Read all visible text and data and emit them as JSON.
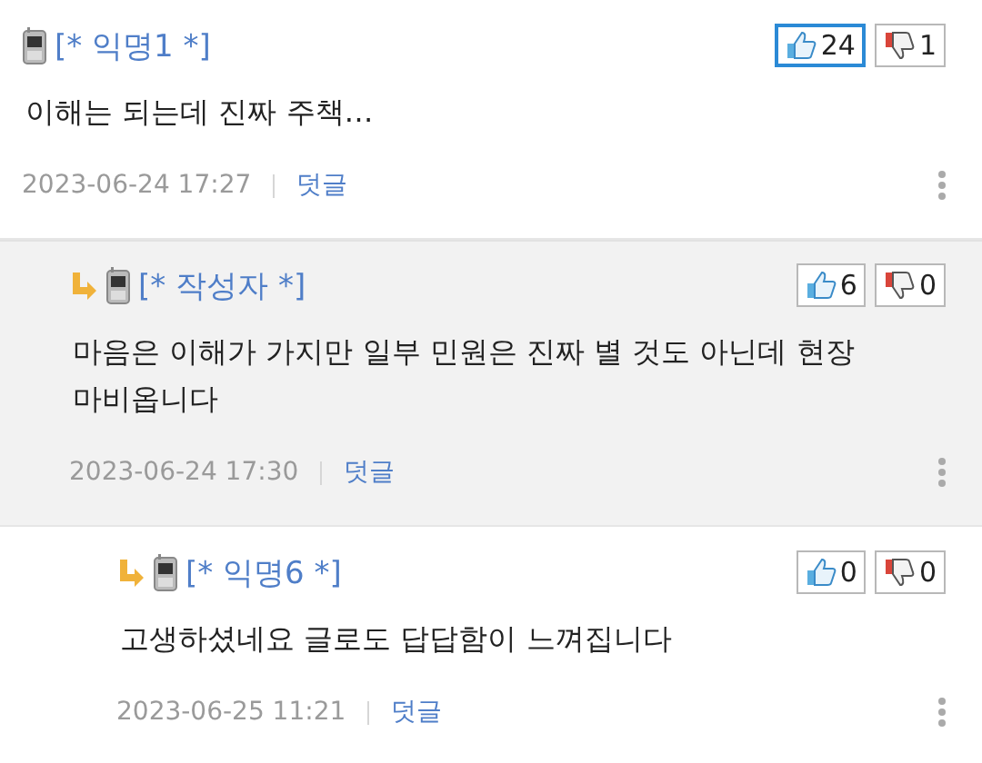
{
  "comments": [
    {
      "author": "[* 익명1 *]",
      "text": "이해는 되는데 진짜 주책…",
      "date": "2023-06-24 17:27",
      "reply": "덧글",
      "likes": "24",
      "like_selected": true,
      "dislikes": "1",
      "highlighted": false,
      "children": [
        {
          "author": "[* 작성자 *]",
          "text": "마음은 이해가 가지만 일부 민원은 진짜 별 것도 아닌데 현장 마비옵니다",
          "date": "2023-06-24 17:30",
          "reply": "덧글",
          "likes": "6",
          "like_selected": false,
          "dislikes": "0",
          "highlighted": true,
          "children": [
            {
              "author": "[* 익명6 *]",
              "text": "고생하셨네요 글로도 답답함이 느껴집니다",
              "date": "2023-06-25 11:21",
              "reply": "덧글",
              "likes": "0",
              "like_selected": false,
              "dislikes": "0",
              "highlighted": false
            }
          ]
        }
      ]
    }
  ]
}
